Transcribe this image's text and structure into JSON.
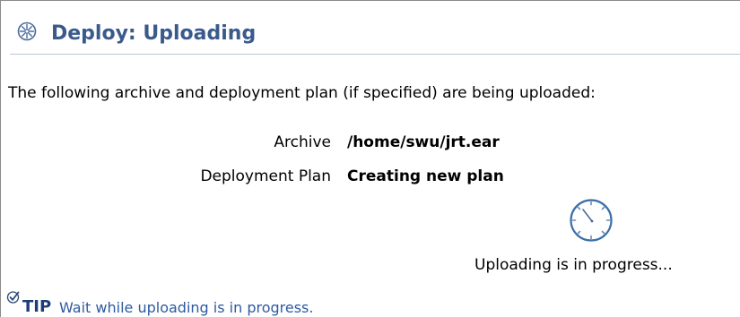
{
  "header": {
    "title": "Deploy: Uploading",
    "icon": "deploy-gear-icon"
  },
  "intro": "The following archive and deployment plan (if specified) are being uploaded:",
  "details": [
    {
      "label": "Archive",
      "value": "/home/swu/jrt.ear"
    },
    {
      "label": "Deployment Plan",
      "value": "Creating new plan"
    }
  ],
  "progress": {
    "icon": "clock-icon",
    "text": "Uploading is in progress..."
  },
  "tip": {
    "icon": "checkmark-icon",
    "label": "TIP",
    "text": "Wait while uploading is in progress."
  },
  "colors": {
    "title": "#3a5a8c",
    "tip_label": "#1e3c78",
    "tip_text": "#2e5aa0",
    "icon": "#4a6a9c"
  }
}
